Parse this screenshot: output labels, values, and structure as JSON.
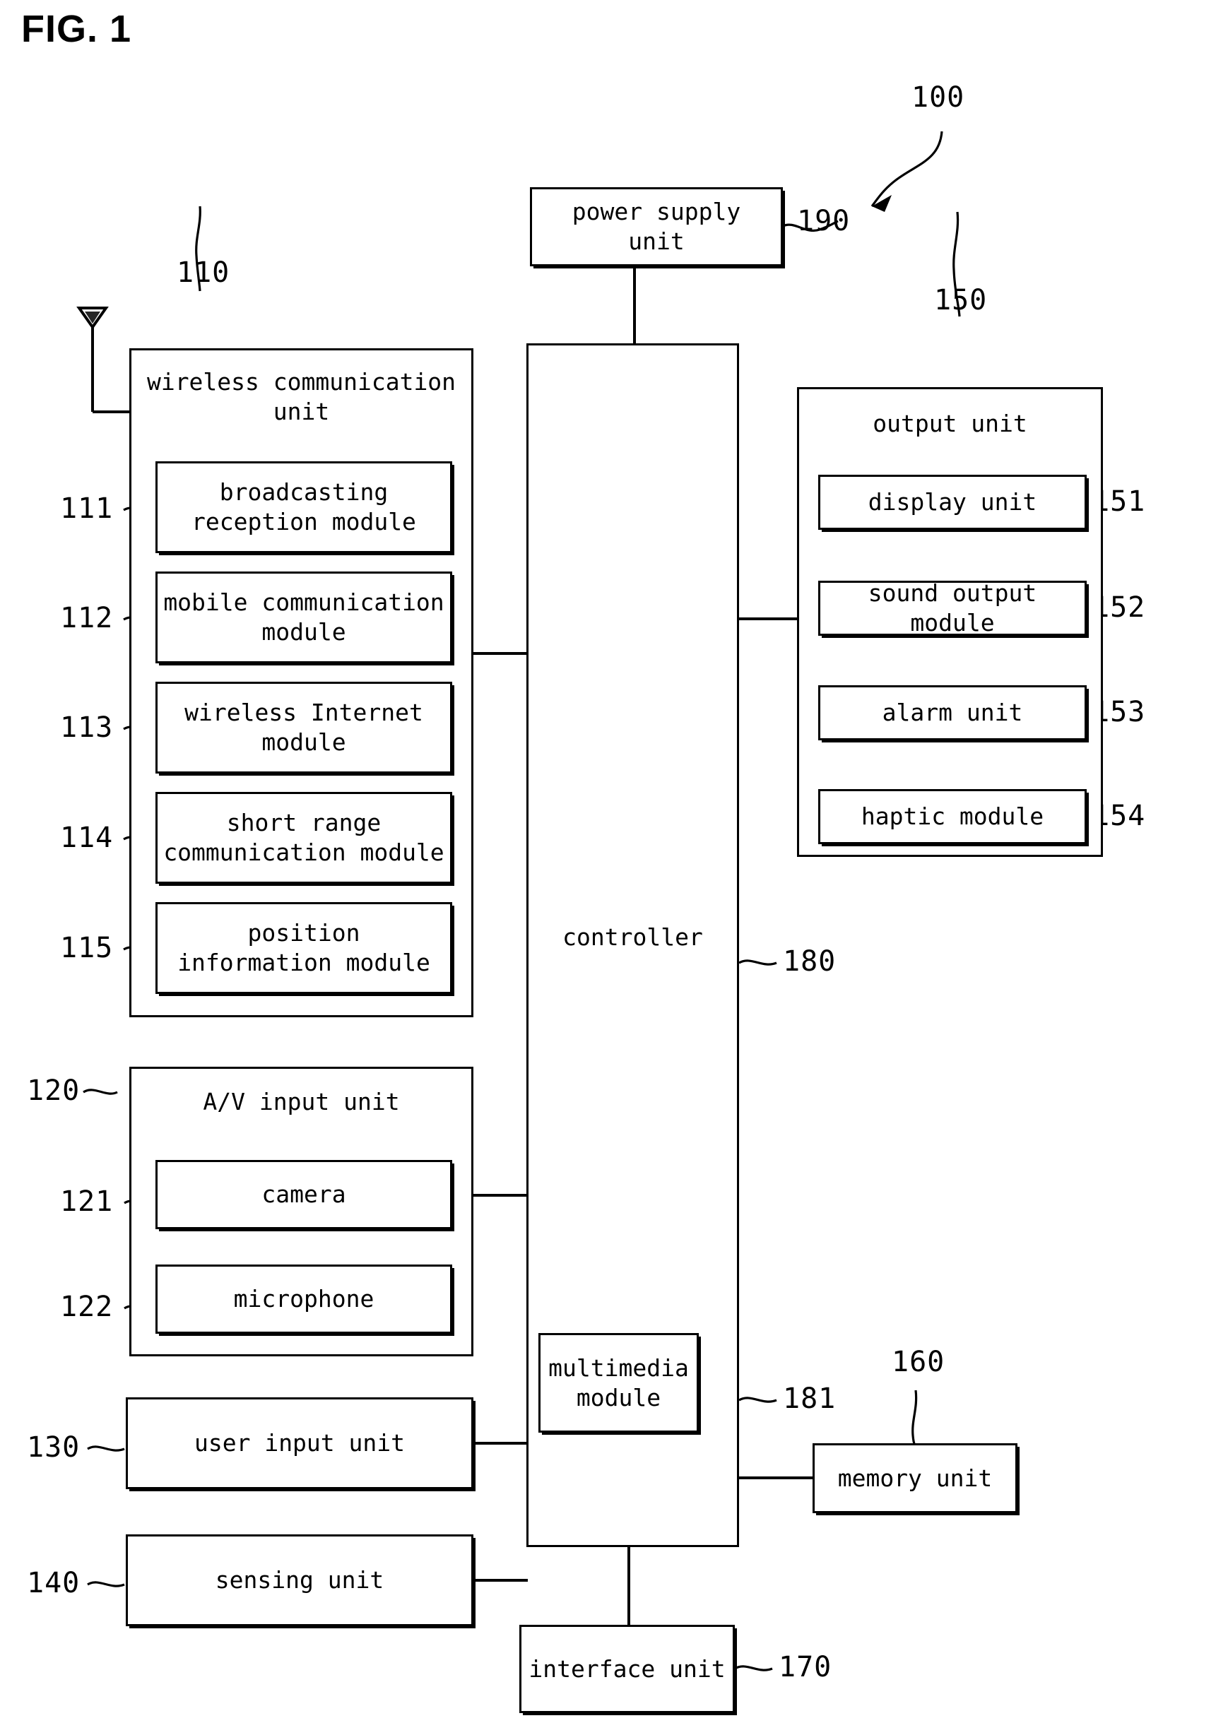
{
  "figure": {
    "title": "FIG. 1",
    "device_ref": "100"
  },
  "blocks": {
    "power_supply": {
      "label": "power supply\nunit",
      "ref": "190"
    },
    "wireless_unit": {
      "label": "wireless communication\nunit",
      "ref": "110",
      "modules": [
        {
          "label": "broadcasting\nreception module",
          "ref": "111"
        },
        {
          "label": "mobile communication\nmodule",
          "ref": "112"
        },
        {
          "label": "wireless Internet\nmodule",
          "ref": "113"
        },
        {
          "label": "short range\ncommunication module",
          "ref": "114"
        },
        {
          "label": "position\ninformation module",
          "ref": "115"
        }
      ]
    },
    "controller": {
      "label": "controller",
      "ref": "180"
    },
    "multimedia_module": {
      "label": "multimedia\nmodule",
      "ref": "181"
    },
    "output_unit": {
      "label": "output unit",
      "ref": "150",
      "modules": [
        {
          "label": "display unit",
          "ref": "151"
        },
        {
          "label": "sound output module",
          "ref": "152"
        },
        {
          "label": "alarm unit",
          "ref": "153"
        },
        {
          "label": "haptic module",
          "ref": "154"
        }
      ]
    },
    "av_input_unit": {
      "label": "A/V input unit",
      "ref": "120",
      "modules": [
        {
          "label": "camera",
          "ref": "121"
        },
        {
          "label": "microphone",
          "ref": "122"
        }
      ]
    },
    "user_input_unit": {
      "label": "user input unit",
      "ref": "130"
    },
    "sensing_unit": {
      "label": "sensing unit",
      "ref": "140"
    },
    "memory_unit": {
      "label": "memory unit",
      "ref": "160"
    },
    "interface_unit": {
      "label": "interface unit",
      "ref": "170"
    }
  },
  "icons": {
    "antenna": "antenna-icon"
  },
  "colors": {
    "stroke": "#000000",
    "background": "#ffffff"
  }
}
